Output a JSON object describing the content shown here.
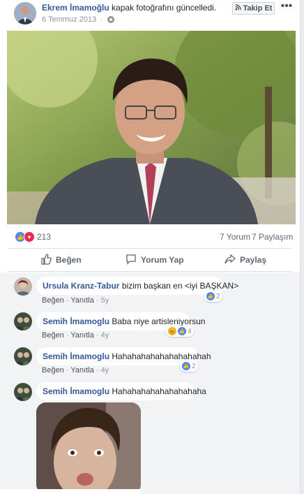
{
  "post": {
    "author": "Ekrem İmamoğlu",
    "action": "kapak fotoğrafını güncelledi.",
    "date": "6 Temmuz 2013",
    "follow_label": "Takip Et",
    "more_label": "•••",
    "reaction_count": "213",
    "comments_count": "7 Yorum",
    "shares_count": "7 Paylaşım"
  },
  "actions": {
    "like": "Beğen",
    "comment": "Yorum Yap",
    "share": "Paylaş"
  },
  "comments": [
    {
      "name": "Ursula Kranz-Tabur",
      "text": "bizim başkan en <iyi BAŞKAN>",
      "like": "Beğen",
      "reply": "Yanıtla",
      "time": "5y",
      "reactions": "2"
    },
    {
      "name": "Semih İmamoglu",
      "text": "Baba niye artisleniyorsun",
      "like": "Beğen",
      "reply": "Yanıtla",
      "time": "4y",
      "reactions": "4"
    },
    {
      "name": "Semih İmamoglu",
      "text": "Hahahahahahahahahahah",
      "like": "Beğen",
      "reply": "Yanıtla",
      "time": "4y",
      "reactions": "2"
    },
    {
      "name": "Semih İmamoglu",
      "text": "Hahahahahahahahahaha"
    }
  ],
  "colors": {
    "link": "#365899",
    "like": "#4a89f3",
    "love": "#f0284a",
    "haha": "#f7b125"
  },
  "icons": {
    "follow": "rss-icon",
    "privacy": "globe-icon",
    "like": "thumbs-up-icon",
    "comment": "speech-bubble-icon",
    "share": "share-arrow-icon"
  }
}
